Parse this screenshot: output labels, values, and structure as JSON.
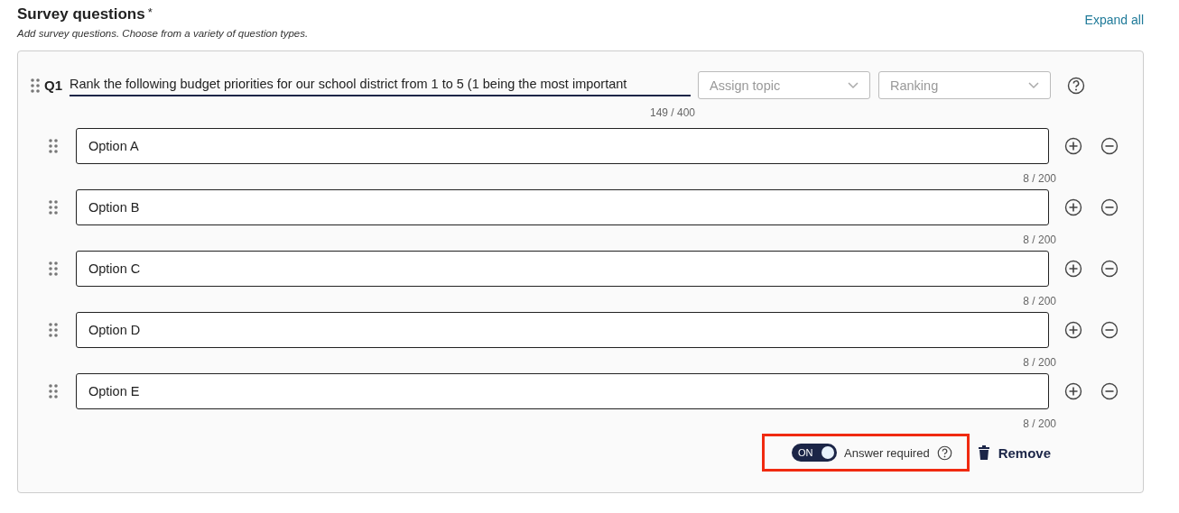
{
  "section": {
    "title": "Survey questions",
    "required_mark": "*",
    "description": "Add survey questions. Choose from a variety of question types.",
    "expand_link": "Expand all"
  },
  "question": {
    "number": "Q1",
    "text": "Rank the following budget priorities for our school district from 1 to 5 (1 being the most important",
    "counter": "149 / 400",
    "topic": {
      "placeholder": "Assign topic"
    },
    "type": {
      "value": "Ranking"
    },
    "options": [
      {
        "value": "Option A",
        "counter": "8 / 200"
      },
      {
        "value": "Option B",
        "counter": "8 / 200"
      },
      {
        "value": "Option C",
        "counter": "8 / 200"
      },
      {
        "value": "Option D",
        "counter": "8 / 200"
      },
      {
        "value": "Option E",
        "counter": "8 / 200"
      }
    ],
    "required": {
      "on": true,
      "state_label": "ON",
      "label": "Answer required",
      "highlighted": true
    },
    "remove": "Remove"
  }
}
